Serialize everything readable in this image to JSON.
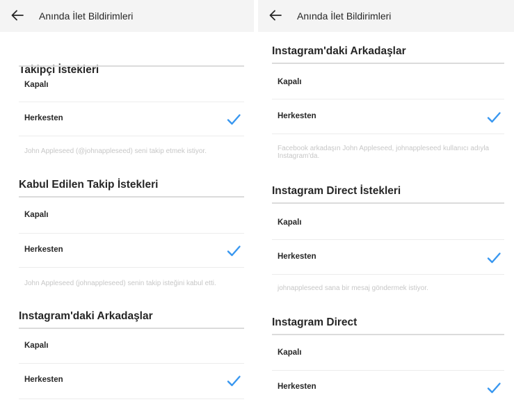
{
  "header": {
    "title": "Anında İlet Bildirimleri"
  },
  "icons": {
    "back": "arrow-left-icon",
    "check": "checkmark-icon"
  },
  "colors": {
    "accent": "#3897f0"
  },
  "option_labels": {
    "off": "Kapalı",
    "everyone": "Herkesten"
  },
  "left": {
    "section1": {
      "title": "Takipçi İstekleri",
      "selected": "Herkesten",
      "caption": "John Appleseed (@johnappleseed) seni takip etmek istiyor."
    },
    "section2": {
      "title": "Kabul Edilen Takip İstekleri",
      "selected": "Herkesten",
      "caption": "John Appleseed (johnappleseed) senin takip isteğini kabul etti."
    },
    "section3": {
      "title": "Instagram'daki Arkadaşlar",
      "selected": "Herkesten"
    }
  },
  "right": {
    "section1": {
      "title": "Instagram'daki Arkadaşlar",
      "selected": "Herkesten",
      "caption": "Facebook arkadaşın John Appleseed, johnappleseed kullanıcı adıyla Instagram'da."
    },
    "section2": {
      "title": "Instagram Direct İstekleri",
      "selected": "Herkesten",
      "caption": "johnappleseed sana bir mesaj göndermek istiyor."
    },
    "section3": {
      "title": "Instagram Direct",
      "selected": "Herkesten"
    }
  }
}
